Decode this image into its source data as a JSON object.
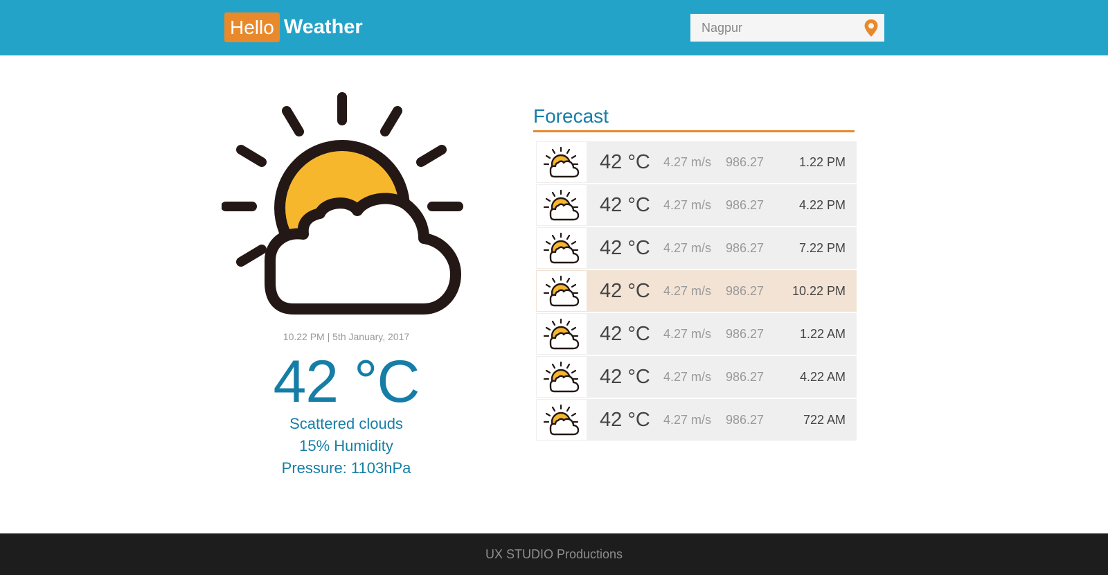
{
  "header": {
    "logo_hello": "Hello",
    "logo_weather": "Weather",
    "search_value": "Nagpur",
    "accent_color": "#e8892b",
    "bar_color": "#24a3c9"
  },
  "current": {
    "icon": "sun-behind-cloud-icon",
    "datetime": "10.22 PM | 5th January, 2017",
    "temperature": "42 °C",
    "condition": "Scattered clouds",
    "humidity": "15% Humidity",
    "pressure": "Pressure: 1103hPa"
  },
  "forecast": {
    "title": "Forecast",
    "rows": [
      {
        "temp": "42 °C",
        "wind": "4.27 m/s",
        "pressure": "986.27",
        "time": "1.22 PM",
        "active": false
      },
      {
        "temp": "42 °C",
        "wind": "4.27 m/s",
        "pressure": "986.27",
        "time": "4.22 PM",
        "active": false
      },
      {
        "temp": "42 °C",
        "wind": "4.27 m/s",
        "pressure": "986.27",
        "time": "7.22 PM",
        "active": false
      },
      {
        "temp": "42 °C",
        "wind": "4.27 m/s",
        "pressure": "986.27",
        "time": "10.22 PM",
        "active": true
      },
      {
        "temp": "42 °C",
        "wind": "4.27 m/s",
        "pressure": "986.27",
        "time": "1.22 AM",
        "active": false
      },
      {
        "temp": "42 °C",
        "wind": "4.27 m/s",
        "pressure": "986.27",
        "time": "4.22 AM",
        "active": false
      },
      {
        "temp": "42 °C",
        "wind": "4.27 m/s",
        "pressure": "986.27",
        "time": "722 AM",
        "active": false
      }
    ]
  },
  "footer": {
    "text": "UX STUDIO Productions"
  }
}
